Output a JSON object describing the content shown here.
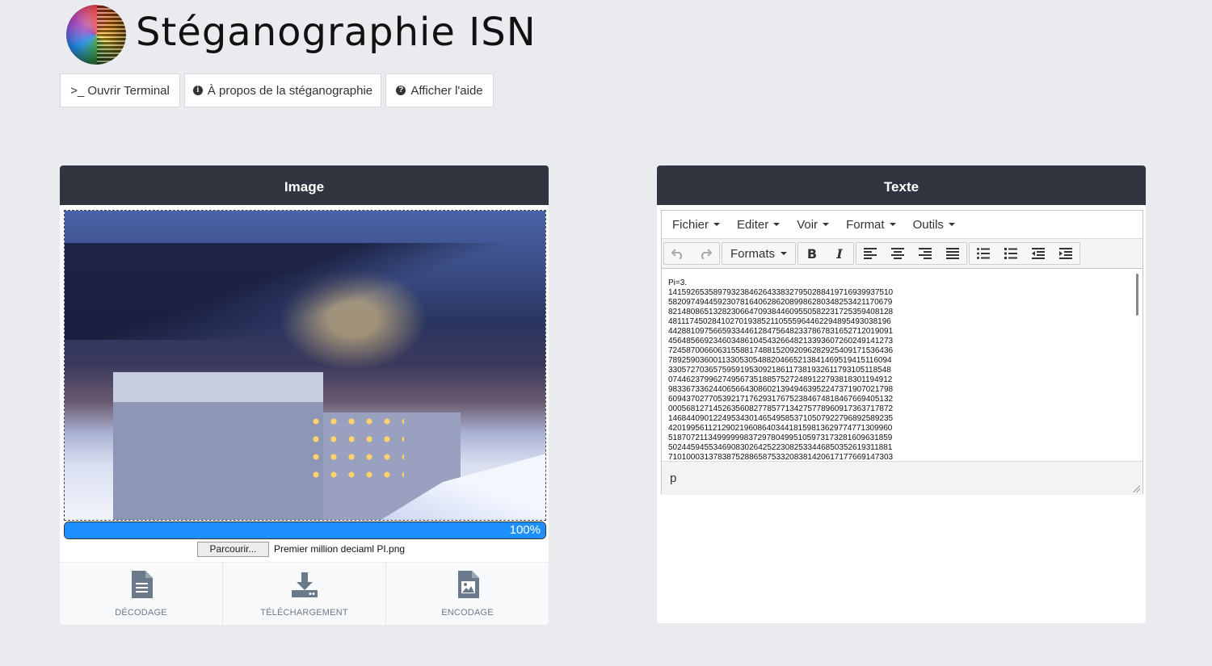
{
  "header": {
    "title": "Stéganographie ISN",
    "buttons": [
      {
        "icon": "terminal-icon",
        "label": ">_ Ouvrir Terminal"
      },
      {
        "icon": "info-icon",
        "label": "À propos de la stéganographie"
      },
      {
        "icon": "help-icon",
        "label": "Afficher l'aide"
      }
    ]
  },
  "image_panel": {
    "title": "Image",
    "progress_percent": 100,
    "progress_label": "100%",
    "browse_label": "Parcourir...",
    "file_name": "Premier million deciaml PI.png",
    "actions": [
      {
        "icon": "document-icon",
        "label": "DÉCODAGE"
      },
      {
        "icon": "download-icon",
        "label": "TÉLÉCHARGEMENT"
      },
      {
        "icon": "image-icon",
        "label": "ENCODAGE"
      }
    ]
  },
  "texte_panel": {
    "title": "Texte",
    "menu": [
      "Fichier",
      "Editer",
      "Voir",
      "Format",
      "Outils"
    ],
    "formats_label": "Formats",
    "status_path": "p",
    "content_lines": [
      "Pi=3.",
      "1415926535897932384626433832795028841971693993751​0",
      "5820974944592307816406286208998628034825342117067​9",
      "8214808651328230664709384460955058223172535940812​8",
      "4811174502841027019385211055596446229489549303819​6",
      "4428810975665933446128475648233786783165271201909​1",
      "4564856692346034861045432664821339360726024914127​3",
      "7245870066063155881748815209209628292540917153643​6",
      "7892590360011330530548820466521384146951941511609​4",
      "3305727036575959195309218611738193261179310511854​8",
      "0744623799627495673518857527248912279381830119491​2",
      "9833673362440656643086021394946395224737190702179​8",
      "6094370277053921717629317675238467481846766940513​2",
      "0005681271452635608277857713427577896091736371787​2",
      "1468440901224953430146549585371050792279689258923​5",
      "4201995611212902196086403441815981362977477130996​0",
      "5187072113499999983729780499510597317328160963185​9",
      "5024459455346908302642522308253344685035261931188​1",
      "7101000313783875288658753320838142061717766914730​3"
    ]
  }
}
